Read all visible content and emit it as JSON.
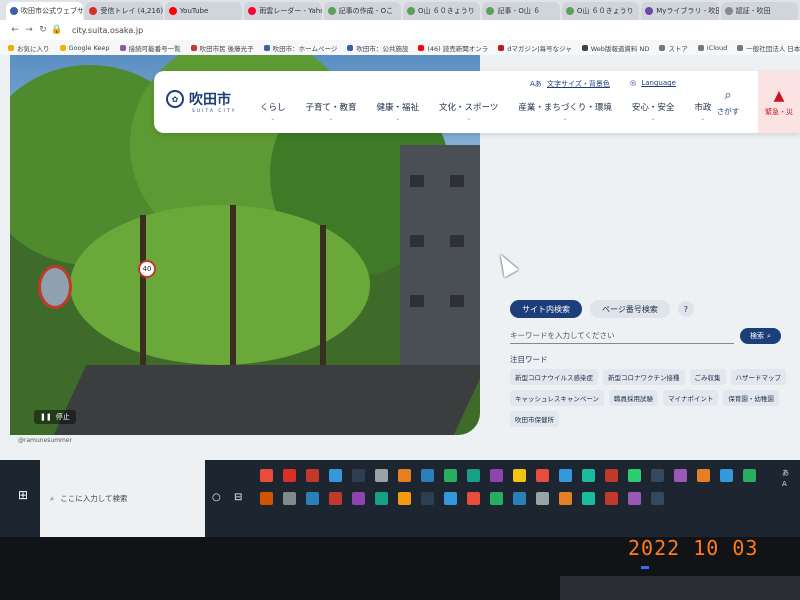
{
  "browser": {
    "tabs": [
      {
        "label": "吹田市公式ウェブサ",
        "color": "#3b5fa8",
        "active": true
      },
      {
        "label": "受信トレイ (4,216)",
        "color": "#d93025",
        "active": false
      },
      {
        "label": "YouTube",
        "color": "#ff0000",
        "active": false
      },
      {
        "label": "雨雲レーダー - Yahoo",
        "color": "#ff0033",
        "active": false
      },
      {
        "label": "記事の作成 - Oこ",
        "color": "#5aa05a",
        "active": false
      },
      {
        "label": "O山 ６０きょうり",
        "color": "#5aa05a",
        "active": false
      },
      {
        "label": "記事 - O山 ６",
        "color": "#5aa05a",
        "active": false
      },
      {
        "label": "O山 ６０きょうり",
        "color": "#5aa05a",
        "active": false
      },
      {
        "label": "Myライブラリ - 吹田",
        "color": "#6a4ca8",
        "active": false
      },
      {
        "label": "認証 - 吹田",
        "color": "#888888",
        "active": false
      }
    ],
    "url": "city.suita.osaka.jp",
    "bookmarks": [
      {
        "label": "お気に入り",
        "color": "#e8b100"
      },
      {
        "label": "Google Keep",
        "color": "#f4b400"
      },
      {
        "label": "接続可能番号一覧",
        "color": "#8a5aa8"
      },
      {
        "label": "吹田市民 後藤光子",
        "color": "#c0392b"
      },
      {
        "label": "吹田市：ホームページ",
        "color": "#3b5fa8"
      },
      {
        "label": "吹田市：公共施設",
        "color": "#3b5fa8"
      },
      {
        "label": "(46) 読売新聞オンラ",
        "color": "#ff0000"
      },
      {
        "label": "dマガジン|毎号なジャ",
        "color": "#c4161c"
      },
      {
        "label": "Web版報道資料 ND",
        "color": "#444444"
      },
      {
        "label": "ストア",
        "color": "#777777"
      },
      {
        "label": "iCloud",
        "color": "#777777"
      },
      {
        "label": "一般社団法人 日本",
        "color": "#777777"
      }
    ]
  },
  "site": {
    "logo_text": "吹田市",
    "logo_sub": "SUITA CITY",
    "utility_font": "文字サイズ・背景色",
    "utility_font_prefix": "Aあ",
    "utility_language": "Language",
    "nav": [
      "くらし",
      "子育て・教育",
      "健康・福祉",
      "文化・スポーツ",
      "産業・まちづくり・環境",
      "安心・安全",
      "市政"
    ],
    "search_label": "さがす",
    "emergency_label": "緊急・災",
    "hero_pause": "停止",
    "hero_credit": "@ramunesummer",
    "road_sign": "40"
  },
  "search_panel": {
    "tab_site": "サイト内検索",
    "tab_page": "ページ番号検索",
    "help": "?",
    "placeholder": "キーワードを入力してください",
    "button": "検索",
    "attention_title": "注目ワード",
    "keywords": [
      "新型コロナウイルス感染症",
      "新型コロナワクチン接種",
      "ごみ収集",
      "ハザードマップ",
      "キャッシュレスキャンペーン",
      "職員採用試験",
      "マイナポイント",
      "保育園・幼稚園",
      "吹田市保健所"
    ]
  },
  "taskbar": {
    "search_placeholder": "ここに入力して検索",
    "tray_top": "あ",
    "tray_bottom": "A",
    "app_colors": [
      "#e74c3c",
      "#d93025",
      "#c0392b",
      "#3498db",
      "#2c3e50",
      "#95a5a6",
      "#e67e22",
      "#2980b9",
      "#27ae60",
      "#16a085",
      "#8e44ad",
      "#f1c40f",
      "#e74c3c",
      "#3498db",
      "#1abc9c",
      "#c0392b",
      "#2ecc71",
      "#34495e",
      "#9b59b6",
      "#e67e22",
      "#3498db",
      "#27ae60",
      "#d35400",
      "#7f8c8d",
      "#2980b9",
      "#c0392b",
      "#8e44ad",
      "#16a085",
      "#f39c12",
      "#2c3e50",
      "#3498db",
      "#e74c3c",
      "#27ae60",
      "#2980b9",
      "#95a5a6",
      "#e67e22",
      "#1abc9c",
      "#c0392b",
      "#9b59b6",
      "#34495e"
    ]
  },
  "photo_stamp": "2022 10 03"
}
